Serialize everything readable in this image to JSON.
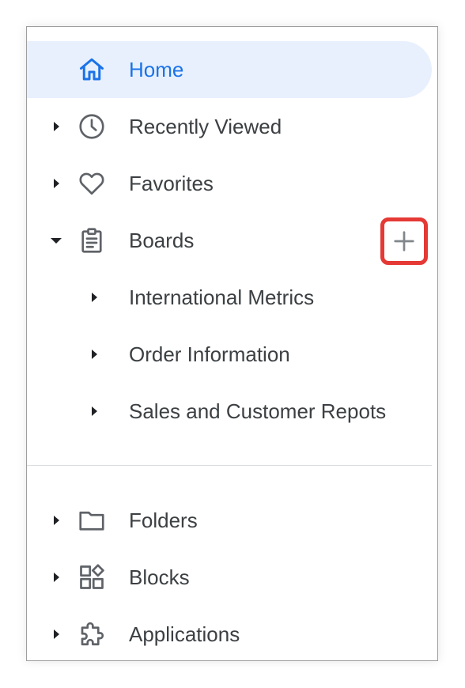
{
  "nav": {
    "home": {
      "label": "Home",
      "icon": "home-icon"
    },
    "recently_viewed": {
      "label": "Recently Viewed",
      "icon": "clock-icon"
    },
    "favorites": {
      "label": "Favorites",
      "icon": "heart-icon"
    },
    "boards": {
      "label": "Boards",
      "icon": "clipboard-icon",
      "add_button_icon": "plus-icon",
      "children": [
        {
          "label": "International Metrics"
        },
        {
          "label": "Order Information"
        },
        {
          "label": "Sales and Customer Repots"
        }
      ]
    },
    "folders": {
      "label": "Folders",
      "icon": "folder-icon"
    },
    "blocks": {
      "label": "Blocks",
      "icon": "blocks-icon"
    },
    "applications": {
      "label": "Applications",
      "icon": "puzzle-icon"
    }
  },
  "colors": {
    "accent": "#1a73e8",
    "active_bg": "#e8f0fe",
    "text": "#3c4043",
    "icon": "#5f6368",
    "highlight_border": "#e53935"
  }
}
